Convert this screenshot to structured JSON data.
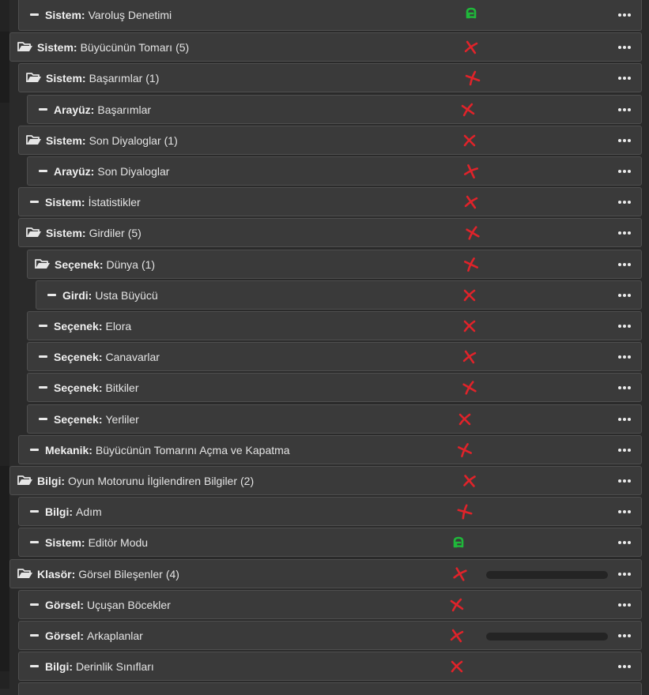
{
  "colors": {
    "row_bg": "#3a3a3a",
    "row_border": "#4f4f4f",
    "status_fail": "#e0232a",
    "status_ok": "#1fb83a"
  },
  "rows": [
    {
      "kind": "item",
      "depth": 1,
      "prefix": "Sistem:",
      "name": "Varoluş Denetimi",
      "count": "",
      "status": "ok"
    },
    {
      "kind": "folder",
      "depth": 0,
      "prefix": "Sistem:",
      "name": "Büyücünün Tomarı",
      "count": "(5)",
      "status": "fail"
    },
    {
      "kind": "folder",
      "depth": 1,
      "prefix": "Sistem:",
      "name": "Başarımlar",
      "count": "(1)",
      "status": "fail"
    },
    {
      "kind": "item",
      "depth": 2,
      "prefix": "Arayüz:",
      "name": "Başarımlar",
      "count": "",
      "status": "fail"
    },
    {
      "kind": "folder",
      "depth": 1,
      "prefix": "Sistem:",
      "name": "Son Diyaloglar",
      "count": "(1)",
      "status": "fail"
    },
    {
      "kind": "item",
      "depth": 2,
      "prefix": "Arayüz:",
      "name": "Son Diyaloglar",
      "count": "",
      "status": "fail"
    },
    {
      "kind": "item",
      "depth": 1,
      "prefix": "Sistem:",
      "name": "İstatistikler",
      "count": "",
      "status": "fail"
    },
    {
      "kind": "folder",
      "depth": 1,
      "prefix": "Sistem:",
      "name": "Girdiler",
      "count": "(5)",
      "status": "fail"
    },
    {
      "kind": "folder",
      "depth": 2,
      "prefix": "Seçenek:",
      "name": "Dünya",
      "count": "(1)",
      "status": "fail"
    },
    {
      "kind": "item",
      "depth": 3,
      "prefix": "Girdi:",
      "name": "Usta Büyücü",
      "count": "",
      "status": "fail"
    },
    {
      "kind": "item",
      "depth": 2,
      "prefix": "Seçenek:",
      "name": "Elora",
      "count": "",
      "status": "fail"
    },
    {
      "kind": "item",
      "depth": 2,
      "prefix": "Seçenek:",
      "name": "Canavarlar",
      "count": "",
      "status": "fail"
    },
    {
      "kind": "item",
      "depth": 2,
      "prefix": "Seçenek:",
      "name": "Bitkiler",
      "count": "",
      "status": "fail"
    },
    {
      "kind": "item",
      "depth": 2,
      "prefix": "Seçenek:",
      "name": "Yerliler",
      "count": "",
      "status": "fail"
    },
    {
      "kind": "item",
      "depth": 1,
      "prefix": "Mekanik:",
      "name": "Büyücünün Tomarını Açma ve Kapatma",
      "count": "",
      "status": "fail"
    },
    {
      "kind": "folder",
      "depth": 0,
      "prefix": "Bilgi:",
      "name": "Oyun Motorunu İlgilendiren Bilgiler",
      "count": "(2)",
      "status": "fail"
    },
    {
      "kind": "item",
      "depth": 1,
      "prefix": "Bilgi:",
      "name": "Adım",
      "count": "",
      "status": "fail"
    },
    {
      "kind": "item",
      "depth": 1,
      "prefix": "Sistem:",
      "name": "Editör Modu",
      "count": "",
      "status": "ok"
    },
    {
      "kind": "folder",
      "depth": 0,
      "prefix": "Klasör:",
      "name": "Görsel Bileşenler",
      "count": "(4)",
      "status": "fail",
      "progress": 0
    },
    {
      "kind": "item",
      "depth": 1,
      "prefix": "Görsel:",
      "name": "Uçuşan Böcekler",
      "count": "",
      "status": "fail"
    },
    {
      "kind": "item",
      "depth": 1,
      "prefix": "Görsel:",
      "name": "Arkaplanlar",
      "count": "",
      "status": "fail",
      "progress": 0
    },
    {
      "kind": "item",
      "depth": 1,
      "prefix": "Bilgi:",
      "name": "Derinlik Sınıfları",
      "count": "",
      "status": "fail"
    }
  ]
}
